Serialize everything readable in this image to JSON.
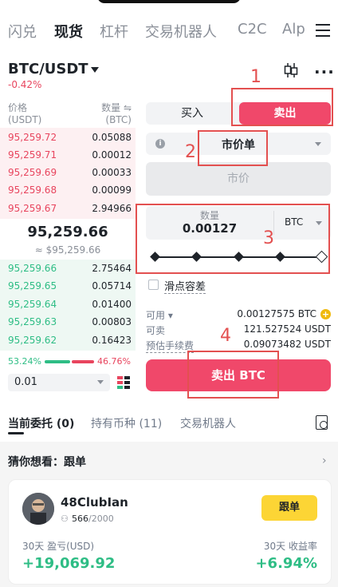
{
  "top_tabs": [
    "闪兑",
    "现货",
    "杠杆",
    "交易机器人",
    "C2C",
    "Alp"
  ],
  "active_tab": "现货",
  "pair": {
    "symbol": "BTC/USDT",
    "change": "-0.42%"
  },
  "order_book": {
    "price_header": "价格",
    "price_unit": "(USDT)",
    "qty_header": "数量 ⇋",
    "qty_unit": "(BTC)",
    "asks": [
      {
        "price": "95,259.72",
        "qty": "0.05088"
      },
      {
        "price": "95,259.71",
        "qty": "0.00012"
      },
      {
        "price": "95,259.69",
        "qty": "0.00033"
      },
      {
        "price": "95,259.68",
        "qty": "0.00099"
      },
      {
        "price": "95,259.67",
        "qty": "2.94966"
      }
    ],
    "last_price": "95,259.66",
    "fiat_price": "≈ $95,259.66",
    "bids": [
      {
        "price": "95,259.66",
        "qty": "2.75464"
      },
      {
        "price": "95,259.65",
        "qty": "0.05714"
      },
      {
        "price": "95,259.64",
        "qty": "0.01400"
      },
      {
        "price": "95,259.63",
        "qty": "0.00803"
      },
      {
        "price": "95,259.62",
        "qty": "0.16423"
      }
    ],
    "buy_ratio": "53.24%",
    "sell_ratio": "46.76%",
    "precision": "0.01"
  },
  "form": {
    "buy_label": "买入",
    "sell_label": "卖出",
    "order_type": "市价单",
    "market_price": "市价",
    "qty_label": "数量",
    "qty_value": "0.00127",
    "qty_unit": "BTC",
    "slippage_label": "滑点容差",
    "available_label": "可用 ▾",
    "available_value": "0.00127575 BTC",
    "sellable_label": "可卖",
    "sellable_value": "121.527524 USDT",
    "fee_label": "预估手续费",
    "fee_value": "0.09073482 USDT",
    "submit_label": "卖出 BTC"
  },
  "annotations": [
    "1",
    "2",
    "3",
    "4"
  ],
  "sub_tabs": [
    "当前委托 (0)",
    "持有币种 (11)",
    "交易机器人"
  ],
  "guess": "猜你想看：跟单",
  "trader": {
    "name": "48ClubIan",
    "followers": "566",
    "followers_max": "/2000",
    "follow_label": "跟单",
    "pnl_label": "30天 盈亏(USD)",
    "pnl_value": "+19,069.92",
    "roi_label": "30天 收益率",
    "roi_value": "+6.94%"
  },
  "colors": {
    "sell": "#f0486a",
    "buy": "#2ebd85",
    "accent": "#fcd535",
    "annotation": "#e35050"
  }
}
